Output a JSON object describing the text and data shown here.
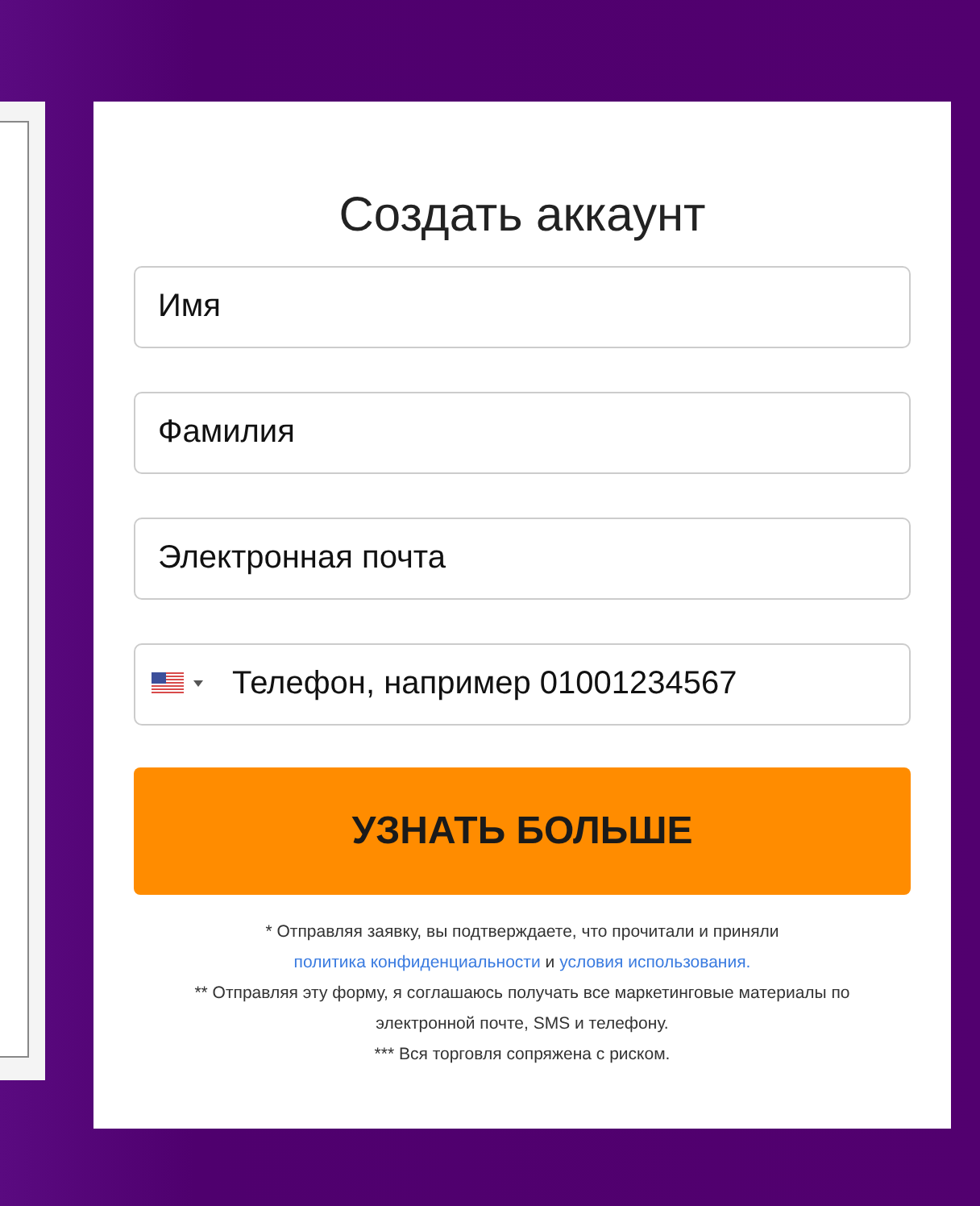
{
  "form": {
    "title": "Создать аккаунт",
    "fields": [
      {
        "kind": "text",
        "placeholder": "Имя"
      },
      {
        "kind": "text",
        "placeholder": "Фамилия"
      },
      {
        "kind": "text",
        "placeholder": "Электронная почта"
      },
      {
        "kind": "phone",
        "placeholder": "Телефон, например 01001234567"
      }
    ],
    "submit": "УЗНАТЬ БОЛЬШЕ",
    "notes": [
      {
        "text": "* Отправляя заявку, вы подтверждаете, что прочитали и приняли",
        "link_1": "политика конфиденциальности",
        "joiner": "и",
        "link_2": "условия использования."
      },
      {
        "text": "** Отправляя эту форму, я соглашаюсь получать все маркетинговые материалы по электронной почте, SMS и телефону."
      },
      {
        "text": "*** Вся торговля сопряжена с риском."
      }
    ]
  }
}
